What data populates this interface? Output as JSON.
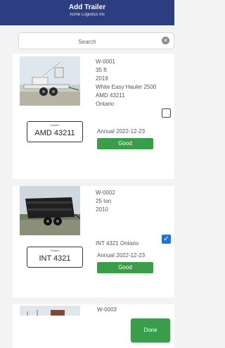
{
  "header": {
    "title": "Add Trailer",
    "subtitle": "Acme Logistics Inc"
  },
  "search": {
    "placeholder": "Search",
    "clear_icon": "clear-circle-icon"
  },
  "trailers": [
    {
      "id": "W-0001",
      "size": "35 ft",
      "year": "2019",
      "model": "White Easy Hauler 2500",
      "plate": "AMD 43211",
      "province": "Ontario",
      "plate_province_label": "Ontario",
      "plate_label": "AMD 43211",
      "annual": "Annual 2022-12-23",
      "status": "Good",
      "checked": false
    },
    {
      "id": "W-0002",
      "size": "25 ton",
      "year": "2010",
      "plate": "INT 4321",
      "province": "Ontario",
      "plate_province_label": "Ontario",
      "plate_label": "INT 4321",
      "annual": "Annual 2022-12-23",
      "status": "Good",
      "checked": true
    },
    {
      "id": "W-0003"
    }
  ],
  "done_label": "Done",
  "colors": {
    "header": "#2c3e7f",
    "status_good": "#3a9d4a",
    "checkbox_checked": "#1e73d6"
  }
}
